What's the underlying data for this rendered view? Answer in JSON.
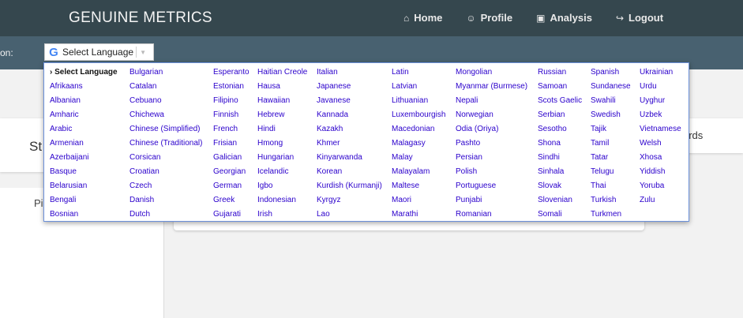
{
  "brand": "GENUINE METRICS",
  "nav": [
    {
      "icon": "home-icon",
      "glyph": "⌂",
      "label": "Home"
    },
    {
      "icon": "profile-icon",
      "glyph": "☺",
      "label": "Profile"
    },
    {
      "icon": "analysis-icon",
      "glyph": "▣",
      "label": "Analysis"
    },
    {
      "icon": "logout-icon",
      "glyph": "↪",
      "label": "Logout"
    }
  ],
  "langbar": {
    "label": "on:"
  },
  "translate": {
    "g_glyph": "G",
    "selected": "Select Language",
    "arrow": "▼"
  },
  "background": {
    "card_left_text": "St",
    "card_right_text": "ords",
    "sidebar_text": "Pi"
  },
  "menu_columns": [
    [
      "Select Language",
      "Afrikaans",
      "Albanian",
      "Amharic",
      "Arabic",
      "Armenian",
      "Azerbaijani",
      "Basque",
      "Belarusian",
      "Bengali",
      "Bosnian"
    ],
    [
      "Bulgarian",
      "Catalan",
      "Cebuano",
      "Chichewa",
      "Chinese (Simplified)",
      "Chinese (Traditional)",
      "Corsican",
      "Croatian",
      "Czech",
      "Danish",
      "Dutch"
    ],
    [
      "Esperanto",
      "Estonian",
      "Filipino",
      "Finnish",
      "French",
      "Frisian",
      "Galician",
      "Georgian",
      "German",
      "Greek",
      "Gujarati"
    ],
    [
      "Haitian Creole",
      "Hausa",
      "Hawaiian",
      "Hebrew",
      "Hindi",
      "Hmong",
      "Hungarian",
      "Icelandic",
      "Igbo",
      "Indonesian",
      "Irish"
    ],
    [
      "Italian",
      "Japanese",
      "Javanese",
      "Kannada",
      "Kazakh",
      "Khmer",
      "Kinyarwanda",
      "Korean",
      "Kurdish (Kurmanji)",
      "Kyrgyz",
      "Lao"
    ],
    [
      "Latin",
      "Latvian",
      "Lithuanian",
      "Luxembourgish",
      "Macedonian",
      "Malagasy",
      "Malay",
      "Malayalam",
      "Maltese",
      "Maori",
      "Marathi"
    ],
    [
      "Mongolian",
      "Myanmar (Burmese)",
      "Nepali",
      "Norwegian",
      "Odia (Oriya)",
      "Pashto",
      "Persian",
      "Polish",
      "Portuguese",
      "Punjabi",
      "Romanian"
    ],
    [
      "Russian",
      "Samoan",
      "Scots Gaelic",
      "Serbian",
      "Sesotho",
      "Shona",
      "Sindhi",
      "Sinhala",
      "Slovak",
      "Slovenian",
      "Somali"
    ],
    [
      "Spanish",
      "Sundanese",
      "Swahili",
      "Swedish",
      "Tajik",
      "Tamil",
      "Tatar",
      "Telugu",
      "Thai",
      "Turkish",
      "Turkmen"
    ],
    [
      "Ukrainian",
      "Urdu",
      "Uyghur",
      "Uzbek",
      "Vietnamese",
      "Welsh",
      "Xhosa",
      "Yiddish",
      "Yoruba",
      "Zulu"
    ]
  ],
  "colors": {
    "nav_bg": "#35474e",
    "langbar_bg": "#486170",
    "link": "#2b00cc",
    "menu_border": "#6b90da"
  }
}
